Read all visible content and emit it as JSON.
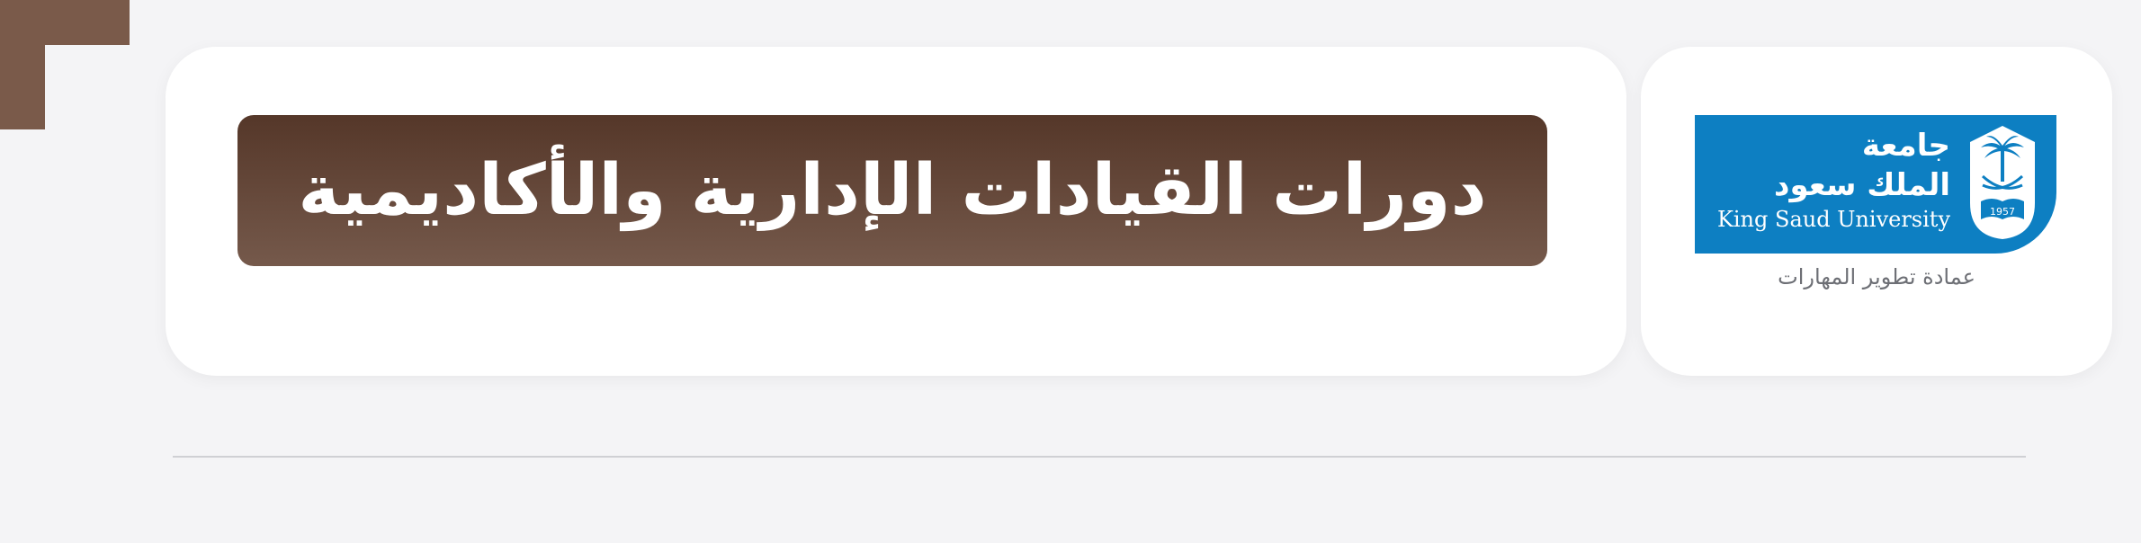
{
  "header": {
    "title": "دورات القيادات الإدارية والأكاديمية"
  },
  "logo": {
    "arabic_line1": "جامعة",
    "arabic_line2": "الملك سعود",
    "english_name": "King Saud University",
    "seal_year": "1957",
    "subtitle": "عمادة تطوير المهارات"
  },
  "colors": {
    "banner_dark": "#553729",
    "banner_light": "#75594b",
    "logo_blue": "#0d7fc2",
    "accent_brown": "#7a5a4a",
    "background": "#f4f4f6"
  },
  "icons": {
    "corner": "corner-bracket-icon",
    "seal": "palm-swords-seal-icon"
  }
}
